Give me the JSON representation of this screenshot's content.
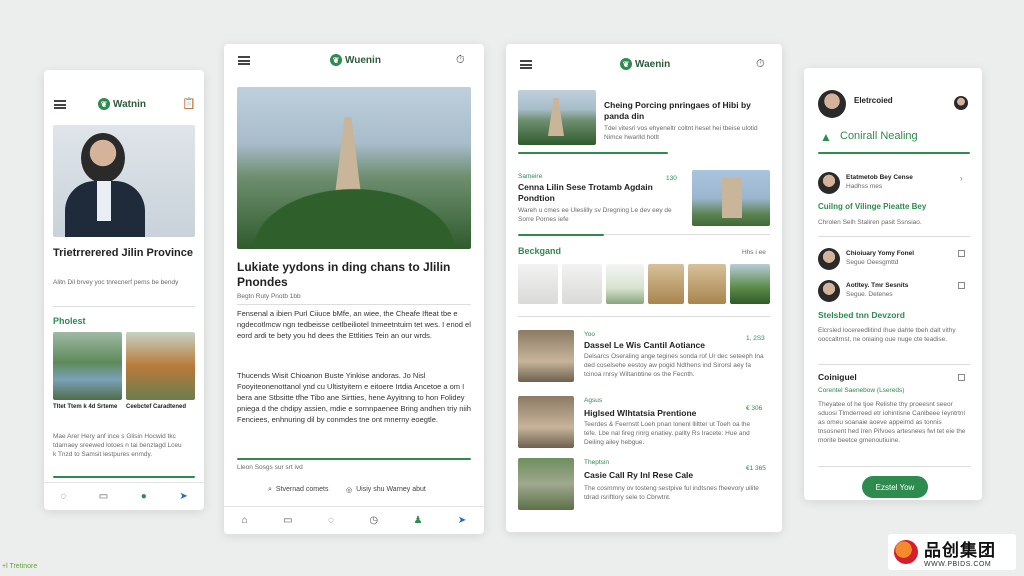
{
  "brand": {
    "name": "Waenin",
    "accent": "#2e8b4e"
  },
  "p1": {
    "logo": "Watnin",
    "title": "Trietrrerered Jilin Province",
    "subtitle": "Alitn Dil brvey yoc tnrecnerf pems be bendy",
    "section": "Pholest",
    "caption_left": "Tltet Ttem k 4d Srteme",
    "caption_right": "Ceebctef Caradtened",
    "body": "Mae Arer Hery anf ince s Glisin Hocwid tkc tdamaey sreewed lotoes n tai benzlagd Lceu k Tnzd to Samsit lestpures enmdy."
  },
  "p2": {
    "logo": "Wuenin",
    "headline": "Lukiate yydons in ding chans to Jlilin Pnondes",
    "byline": "Begtn Ruty Pnotb 1bb",
    "para1": "Fensenal a ibien Purl Ciiuce bMfe, an wiee, the Cheafe Ifteat tbe e ngdecotlmcw ngn tedbeisse cetlbeiliotel Inmeetntuim tet wes. I enod el eord ardi te bety you hd dees the Ettlities Tein an our wrds.",
    "para2": "Thucends Wisit Chioanon Buste Yinkise andoras. Jo Nisl Fooyiteonenottanol ynd cu Ultistyitern e eitoere Irtdia Ancetoe a om I bera ane Stbsitte tfhe Tibo ane Sirtties, hene Ayyitnng to hon Folidey pniega d the chdipy assien, mdie e sornnpaenee Bring andhen triy niih Fenciees, enhnuring dil by conmdes tne ont mnerny eoegtle.",
    "note": "Lleon Sosgs sur srt ivd",
    "action1": "Stvernad comets",
    "action2": "Uisiy shu Warney abut"
  },
  "p3": {
    "logo": "Waenin",
    "top_title": "Cheing Porcing pnringaes of Hibi by panda din",
    "top_desc": "Tdei vitesri vos ehyeneltr coltnt hesel hei tbeise ulotid Nimce hwarlld hotlt",
    "label1": "Sameire",
    "num1": "130",
    "story_title": "Cenna Lilin Sese Trotamb Agdain Pondtion",
    "story_desc": "Wareh u cmes ee Uleslilly sv Dregning Le dev eey de Sorre Pornes iefe",
    "section": "Beckgand",
    "section_more": "Hhs i ee",
    "rows": [
      {
        "tag": "Yoo",
        "title": "Dassel Le Wis Cantil Aotiance",
        "num": "1, 2S3",
        "desc": "Delsarcs Oseraling ange tegines sonda rof Ur dec seteeph Ina ded coselsehe eestoy aw pogid Ndthens ind Sirorsl aey fa tcinoa rnrsy Wiltanbtine os the Fecnth."
      },
      {
        "tag": "Agsus",
        "title": "Higlsed Wlhtatsia Prentione",
        "num": "€ 306",
        "desc": "Teerdes & Feernstt Loeh pnan lonenl lliltter ut Toeh oa lhe tefe. Lbe nal fireg rinrg enatiey. pallty Rs Iracete: Hue and Deiling ailey hebgue."
      },
      {
        "tag": "Theptsin",
        "title": "Casie Call Ry Inl Rese Cale",
        "num": "€1 365",
        "desc": "The cosmmny ov tosteng sestpive ful indtsnes fheevory uilite tdrad rsriftlory sele to Cbrwtnt."
      }
    ]
  },
  "p4": {
    "profile_name": "Eletrcoied",
    "heading": "Conirall Nealing",
    "items": [
      {
        "name": "Etatmetob Bey Cense",
        "sub": "Hadhss mes"
      },
      {
        "name": "Chioiuary Yomy Fonel",
        "sub": "Segue Oeesgmttd"
      },
      {
        "name": "Aotltey. Tmr Sesnits",
        "sub": "Segue. Detenes"
      }
    ],
    "link1_title": "Cuilng of Vilinge Pieatte Bey",
    "link1_desc": "Chrolen Selh Staliren  pasit Ssnsiao.",
    "link2_title": "Stelsbed tnn Devzord",
    "link2_desc": "Elcrsled locereedlitind Ihue dahte tbeh dalt vithy ooccaltrnst, ne oniaing oue nuge cte teadise.",
    "section": "Coiniguel",
    "section_sub": "Corentel Saenebow (Lsereds)",
    "section_desc": "Theyatee of he tjoe Relishe thy proeesnt seeor sduosi Tlmderreed etr iohintisne Canlbeee Ieyntrtnl as omeu soanaie aoeve appeimd as tonnis tnsosnent hed Iren Pifvoes artesnees fwl tet eie the morite beetce gmenoutiuine.",
    "button": "Ezstel Yow"
  },
  "footer_note": "+l Tretinore",
  "watermark": {
    "cn": "品创集团",
    "url": "WWW.PBIDS.COM"
  }
}
